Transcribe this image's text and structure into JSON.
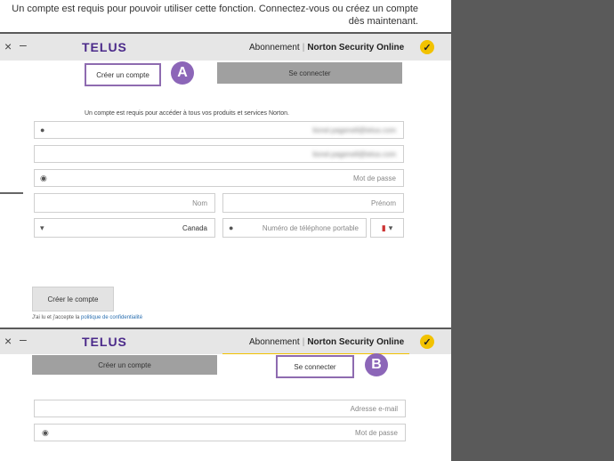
{
  "intro": {
    "lines": [
      "Un compte est requis pour pouvoir utiliser cette fonction. Connectez-vous ou créez un compte",
      "dès maintenant."
    ]
  },
  "window_a": {
    "brand": "Norton Security Online",
    "section": "Abonnement",
    "partner": "TELUS",
    "tab_signin": "Se connecter",
    "tab_create": "Créer un compte",
    "badge": "A",
    "intro_text": "Un compte est requis pour accéder à tous vos produits et services Norton.",
    "email_value": "lionel.pagenell@telus.com",
    "email_confirm_value": "lionel.pagenell@telus.com",
    "password_placeholder": "Mot de passe",
    "firstname_placeholder": "Prénom",
    "lastname_placeholder": "Nom",
    "phone_placeholder": "Numéro de téléphone portable",
    "country_value": "Canada",
    "create_button": "Créer le compte",
    "privacy_prefix": "J'ai lu et j'accepte la",
    "privacy_link": "politique de confidentialité"
  },
  "window_b": {
    "brand": "Norton Security Online",
    "section": "Abonnement",
    "partner": "TELUS",
    "tab_create": "Créer un compte",
    "tab_signin": "Se connecter",
    "badge": "B",
    "email_placeholder": "Adresse e-mail",
    "password_placeholder": "Mot de passe"
  },
  "colors": {
    "accent": "#f2c200",
    "highlight": "#8e6bb0",
    "telus": "#4b2a8a"
  }
}
